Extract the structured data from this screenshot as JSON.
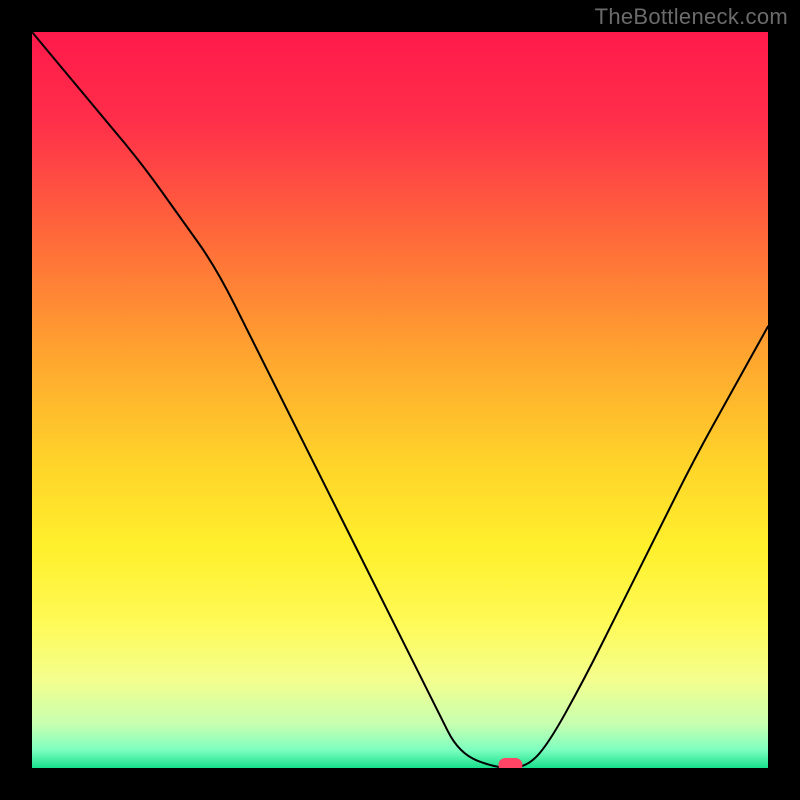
{
  "watermark": {
    "text": "TheBottleneck.com"
  },
  "chart_data": {
    "type": "line",
    "title": "",
    "xlabel": "",
    "ylabel": "",
    "xlim": [
      0,
      100
    ],
    "ylim": [
      0,
      100
    ],
    "series": [
      {
        "name": "bottleneck-curve",
        "x": [
          0,
          5,
          10,
          15,
          20,
          25,
          30,
          35,
          40,
          45,
          50,
          55,
          58,
          63,
          67,
          70,
          75,
          80,
          85,
          90,
          95,
          100
        ],
        "y": [
          100,
          94,
          88,
          82,
          75,
          68,
          58,
          48,
          38,
          28,
          18,
          8,
          2,
          0,
          0,
          3,
          12,
          22,
          32,
          42,
          51,
          60
        ]
      }
    ],
    "marker": {
      "x": 65,
      "y": 0
    },
    "gradient_stops": [
      {
        "offset": 0.0,
        "color": "#ff1a4b"
      },
      {
        "offset": 0.12,
        "color": "#ff2e4a"
      },
      {
        "offset": 0.28,
        "color": "#ff6a3a"
      },
      {
        "offset": 0.44,
        "color": "#ffa52f"
      },
      {
        "offset": 0.58,
        "color": "#ffd22a"
      },
      {
        "offset": 0.7,
        "color": "#fff02c"
      },
      {
        "offset": 0.8,
        "color": "#fffa55"
      },
      {
        "offset": 0.88,
        "color": "#f4ff8e"
      },
      {
        "offset": 0.94,
        "color": "#c8ffb0"
      },
      {
        "offset": 0.975,
        "color": "#7effc0"
      },
      {
        "offset": 1.0,
        "color": "#18e08c"
      }
    ],
    "marker_color": "#ff4466",
    "line_color": "#000000",
    "line_width": 2
  }
}
